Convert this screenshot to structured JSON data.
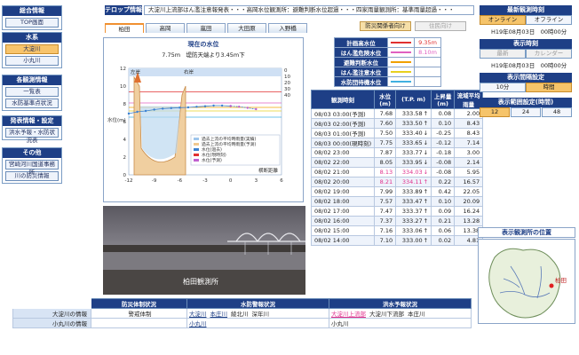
{
  "left_nav": [
    {
      "header": "総合情報",
      "buttons": [
        {
          "label": "TOP画面",
          "style": "plain"
        }
      ]
    },
    {
      "header": "水系",
      "buttons": [
        {
          "label": "大淀川",
          "style": "orange"
        },
        {
          "label": "小丸川",
          "style": "plain"
        }
      ]
    },
    {
      "header": "各観測情報",
      "buttons": [
        {
          "label": "一覧表",
          "style": "plain"
        },
        {
          "label": "水防基準点状況",
          "style": "plain"
        }
      ]
    },
    {
      "header": "発表情報・設定",
      "buttons": [
        {
          "label": "洪水予報・水防状況表",
          "style": "plain"
        }
      ]
    },
    {
      "header": "その他",
      "buttons": [
        {
          "label": "宮崎河川国道事務所",
          "style": "plain"
        },
        {
          "label": "川の防災情報",
          "style": "plain"
        }
      ]
    }
  ],
  "telop": {
    "label": "テロップ情報",
    "text": "大淀川上流部はん濫注意報発表・・・高岡水位観測所：避難判断水位超過・・・四家雨量観測所：基準雨量超過・・・"
  },
  "tabs": [
    "柏田",
    "高岡",
    "嵐田",
    "大田原",
    "入野橋"
  ],
  "mode_buttons": {
    "bosai": "防災関係者向け",
    "jumin": "住民向け"
  },
  "chart": {
    "title": "現在の水位",
    "subtitle": "7.75m　堤防天端より3.45m下",
    "ylabel": "水位(m)",
    "xlabel": "横断距離",
    "legend": [
      "過去上流の平均時雨量(実績)",
      "過去上流の平均時雨量(予測)",
      "水位(過去)",
      "水位(現時刻)",
      "水位(予測)"
    ],
    "label_left": "左岸",
    "label_right": "右岸"
  },
  "chart_data": {
    "type": "line",
    "title": "現在の水位",
    "y_left_ticks": [
      12,
      10,
      8,
      6,
      4,
      2,
      0
    ],
    "y_right_ticks": [
      0,
      10,
      20,
      30,
      40
    ],
    "x_ticks": [
      -12,
      -9,
      -6,
      -3,
      0,
      3,
      6
    ],
    "series": [
      {
        "name": "水位(過去)",
        "x": [
          -12,
          -11,
          -10,
          -9,
          -8,
          -7,
          -6,
          -5,
          -4,
          -3,
          -2,
          -1,
          0
        ],
        "values": [
          6.9,
          7.1,
          7.2,
          7.35,
          7.46,
          7.52,
          7.57,
          7.6,
          7.67,
          7.73,
          7.8,
          7.8,
          7.75
        ]
      },
      {
        "name": "水位(予測)",
        "x": [
          0,
          1,
          2,
          3
        ],
        "values": [
          7.75,
          7.68,
          7.55,
          7.4
        ]
      }
    ],
    "ylim": [
      0,
      12
    ]
  },
  "camera": {
    "label": "柏田観測所"
  },
  "thresholds": [
    {
      "label": "計画高水位",
      "color": "#e03030",
      "value": "9.35m"
    },
    {
      "label": "はん濫危険水位",
      "color": "#e060c0",
      "value": "8.10m"
    },
    {
      "label": "避難判断水位",
      "color": "#f0a000",
      "value": ""
    },
    {
      "label": "はん濫注意水位",
      "color": "#e8d020",
      "value": ""
    },
    {
      "label": "水防団待機水位",
      "color": "#40b0e0",
      "value": ""
    }
  ],
  "table": {
    "headers": [
      "観測時刻",
      "水位(m)",
      "(T.P. m)",
      "上昇量(m)",
      "流域平均雨量"
    ],
    "rows": [
      {
        "time": "08/03 03:00(予測)",
        "level": "7.68",
        "tp": "333.58",
        "arrow": "↑",
        "rise": "0.08",
        "rain": "2.00"
      },
      {
        "time": "08/03 02:00(予測)",
        "level": "7.60",
        "tp": "333.50",
        "arrow": "↑",
        "rise": "0.10",
        "rain": "8.43"
      },
      {
        "time": "08/03 01:00(予測)",
        "level": "7.50",
        "tp": "333.40",
        "arrow": "↓",
        "rise": "-0.25",
        "rain": "8.43"
      },
      {
        "time": "08/03 00:00(現時刻)",
        "level": "7.75",
        "tp": "333.65",
        "arrow": "↓",
        "rise": "-0.12",
        "rain": "7.14"
      },
      {
        "time": "08/02 23:00",
        "level": "7.87",
        "tp": "333.77",
        "arrow": "↓",
        "rise": "-0.18",
        "rain": "3.00"
      },
      {
        "time": "08/02 22:00",
        "level": "8.05",
        "tp": "333.95",
        "arrow": "↓",
        "rise": "-0.08",
        "rain": "2.14"
      },
      {
        "time": "08/02 21:00",
        "level": "8.13",
        "tp": "334.03",
        "arrow": "↓",
        "rise": "-0.08",
        "rain": "5.95",
        "pink": true
      },
      {
        "time": "08/02 20:00",
        "level": "8.21",
        "tp": "334.11",
        "arrow": "↑",
        "rise": "0.22",
        "rain": "16.57",
        "pink": true
      },
      {
        "time": "08/02 19:00",
        "level": "7.99",
        "tp": "333.89",
        "arrow": "↑",
        "rise": "0.42",
        "rain": "22.05"
      },
      {
        "time": "08/02 18:00",
        "level": "7.57",
        "tp": "333.47",
        "arrow": "↑",
        "rise": "0.10",
        "rain": "20.09"
      },
      {
        "time": "08/02 17:00",
        "level": "7.47",
        "tp": "333.37",
        "arrow": "↑",
        "rise": "0.09",
        "rain": "16.24"
      },
      {
        "time": "08/02 16:00",
        "level": "7.37",
        "tp": "333.27",
        "arrow": "↑",
        "rise": "0.21",
        "rain": "13.28"
      },
      {
        "time": "08/02 15:00",
        "level": "7.16",
        "tp": "333.06",
        "arrow": "↑",
        "rise": "0.06",
        "rain": "13.38"
      },
      {
        "time": "08/02 14:00",
        "level": "7.10",
        "tp": "333.00",
        "arrow": "↑",
        "rise": "0.02",
        "rain": "4.81"
      }
    ]
  },
  "right": {
    "latest_header": "最新観測時刻",
    "online": "オンライン",
    "offline": "オフライン",
    "latest_time": "H19年08月03日　00時00分",
    "display_time_header": "表示時刻",
    "btn_latest": "最新",
    "btn_calendar": "カレンダー",
    "display_time": "H19年08月03日　00時00分",
    "interval_header": "表示間隔設定",
    "interval_options": [
      "10分",
      "時間"
    ],
    "range_header": "表示範囲設定(時間)",
    "range_options": [
      "12",
      "24",
      "48"
    ],
    "map_header": "表示観測所の位置",
    "map_marker": "柏田"
  },
  "bottom": {
    "headers": [
      "",
      "防災体制状況",
      "水防警報状況",
      "洪水予報状況"
    ],
    "rows": [
      {
        "label": "大淀川の情報",
        "bosai": "警戒体制",
        "suibo": [
          "大淀川",
          "本庄川",
          "綾北川",
          "深年川"
        ],
        "kozui": [
          "大淀川上流部",
          "大淀川下流部",
          "本庄川"
        ]
      },
      {
        "label": "小丸川の情報",
        "bosai": "",
        "suibo": [
          "小丸川"
        ],
        "kozui": [
          "小丸川"
        ]
      }
    ]
  }
}
